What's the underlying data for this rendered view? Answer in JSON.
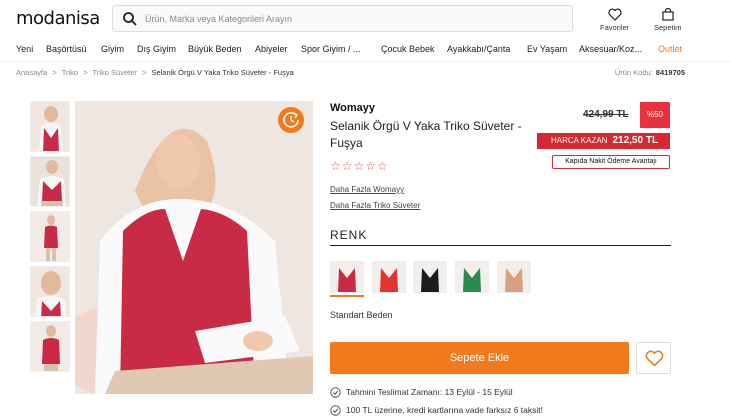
{
  "header": {
    "logo": "modanisa",
    "search_placeholder": "Ürün, Marka veya Kategorileri Arayın",
    "favorites_label": "Favoriler",
    "cart_label": "Sepetim"
  },
  "nav": [
    "Yeni",
    "Başörtüsü",
    "Giyim",
    "Dış Giyim",
    "Büyük Beden",
    "Abiyeler",
    "Spor Giyim / ...",
    "Çocuk Bebek",
    "Ayakkabı/Çanta",
    "Ev Yaşam",
    "Aksesuar/Koz...",
    "Outlet"
  ],
  "breadcrumb": [
    "Anasayfa",
    ">",
    "Triko",
    ">",
    "Triko Süveter",
    ">",
    "Selanik Örgü V Yaka Triko Süveter - Fuşya"
  ],
  "product": {
    "code_label": "Ürün Kodu:",
    "code": "8419705",
    "brand": "Womayy",
    "title": "Selanik Örgü V Yaka Triko Süveter - Fuşya",
    "rating_stars": "☆☆☆☆☆",
    "old_price": "424,99 TL",
    "discount": "%50",
    "harca_label": "HARCA KAZAN",
    "harca_price": "212,50 TL",
    "kapida": "Kapıda Nakit Ödeme Avantajı",
    "link_brand": "Daha Fazla Womayy",
    "link_category": "Daha Fazla Triko Süveter",
    "color_heading": "RENK",
    "size": "Standart Beden",
    "add_to_cart": "Sepete Ekle",
    "delivery": "Tahmini Teslimat Zamanı: 13 Eylül - 15 Eylül",
    "installment": "100 TL üzerine, kredi kartlarına vade farksız 6 taksit!"
  },
  "colors": {
    "accent": "#f27a1a",
    "discount_red": "#e8313b",
    "swatches": [
      "#c92a45",
      "#e3342f",
      "#1c1c1c",
      "#2d8a4e",
      "#d9a07e"
    ]
  },
  "icons": [
    "search-icon",
    "heart-icon",
    "bag-icon",
    "360-view-icon",
    "star-icon",
    "check-circle-icon"
  ]
}
